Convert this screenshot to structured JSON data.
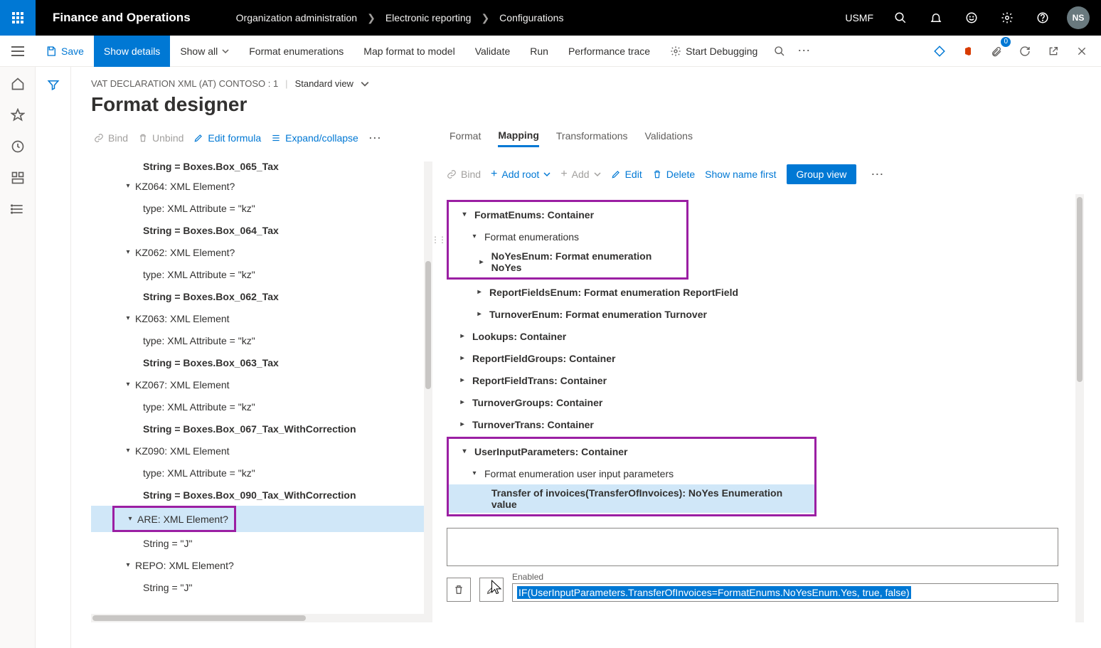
{
  "header": {
    "appTitle": "Finance and Operations",
    "breadcrumb": [
      "Organization administration",
      "Electronic reporting",
      "Configurations"
    ],
    "org": "USMF",
    "userInitials": "NS"
  },
  "toolbar": {
    "save": "Save",
    "showDetails": "Show details",
    "showAll": "Show all",
    "formatEnum": "Format enumerations",
    "mapFormat": "Map format to model",
    "validate": "Validate",
    "run": "Run",
    "perf": "Performance trace",
    "debug": "Start Debugging",
    "attachBadge": "0"
  },
  "pageHeader": {
    "crumb": "VAT DECLARATION XML (AT) CONTOSO : 1",
    "view": "Standard view",
    "title": "Format designer"
  },
  "leftActions": {
    "bind": "Bind",
    "unbind": "Unbind",
    "editFormula": "Edit formula",
    "expand": "Expand/collapse"
  },
  "leftTree": [
    {
      "indent": 55,
      "caret": "",
      "bold": true,
      "text": "String = Boxes.Box_065_Tax",
      "clip": true
    },
    {
      "indent": 44,
      "caret": "▾",
      "bold": false,
      "text": "KZ064: XML Element?"
    },
    {
      "indent": 55,
      "caret": "",
      "bold": false,
      "text": "type: XML Attribute = \"kz\""
    },
    {
      "indent": 55,
      "caret": "",
      "bold": true,
      "text": "String = Boxes.Box_064_Tax"
    },
    {
      "indent": 44,
      "caret": "▾",
      "bold": false,
      "text": "KZ062: XML Element?"
    },
    {
      "indent": 55,
      "caret": "",
      "bold": false,
      "text": "type: XML Attribute = \"kz\""
    },
    {
      "indent": 55,
      "caret": "",
      "bold": true,
      "text": "String = Boxes.Box_062_Tax"
    },
    {
      "indent": 44,
      "caret": "▾",
      "bold": false,
      "text": "KZ063: XML Element"
    },
    {
      "indent": 55,
      "caret": "",
      "bold": false,
      "text": "type: XML Attribute = \"kz\""
    },
    {
      "indent": 55,
      "caret": "",
      "bold": true,
      "text": "String = Boxes.Box_063_Tax"
    },
    {
      "indent": 44,
      "caret": "▾",
      "bold": false,
      "text": "KZ067: XML Element"
    },
    {
      "indent": 55,
      "caret": "",
      "bold": false,
      "text": "type: XML Attribute = \"kz\""
    },
    {
      "indent": 55,
      "caret": "",
      "bold": true,
      "text": "String = Boxes.Box_067_Tax_WithCorrection"
    },
    {
      "indent": 44,
      "caret": "▾",
      "bold": false,
      "text": "KZ090: XML Element"
    },
    {
      "indent": 55,
      "caret": "",
      "bold": false,
      "text": "type: XML Attribute = \"kz\""
    },
    {
      "indent": 55,
      "caret": "",
      "bold": true,
      "text": "String = Boxes.Box_090_Tax_WithCorrection"
    },
    {
      "indent": 44,
      "caret": "▾",
      "bold": false,
      "text": "ARE: XML Element?",
      "sel": true,
      "highlight": true
    },
    {
      "indent": 55,
      "caret": "",
      "bold": false,
      "text": "String = \"J\""
    },
    {
      "indent": 44,
      "caret": "▾",
      "bold": false,
      "text": "REPO: XML Element?"
    },
    {
      "indent": 55,
      "caret": "",
      "bold": false,
      "text": "String = \"J\""
    }
  ],
  "tabs": [
    "Format",
    "Mapping",
    "Transformations",
    "Validations"
  ],
  "activeTab": "Mapping",
  "rightActions": {
    "bind": "Bind",
    "addRoot": "Add root",
    "add": "Add",
    "edit": "Edit",
    "delete": "Delete",
    "showName": "Show name first",
    "groupView": "Group view"
  },
  "rightTreeBox1": [
    {
      "indent": 4,
      "caret": "▾",
      "bold": true,
      "text": "FormatEnums: Container"
    },
    {
      "indent": 18,
      "caret": "▾",
      "bold": false,
      "text": "Format enumerations"
    },
    {
      "indent": 28,
      "caret": "▸",
      "bold": true,
      "text": "NoYesEnum: Format enumeration NoYes"
    }
  ],
  "rightTreeMiddle": [
    {
      "indent": 28,
      "caret": "▸",
      "bold": true,
      "text": "ReportFieldsEnum: Format enumeration ReportField"
    },
    {
      "indent": 28,
      "caret": "▸",
      "bold": true,
      "text": "TurnoverEnum: Format enumeration Turnover"
    },
    {
      "indent": 4,
      "caret": "▸",
      "bold": true,
      "text": "Lookups: Container"
    },
    {
      "indent": 4,
      "caret": "▸",
      "bold": true,
      "text": "ReportFieldGroups: Container"
    },
    {
      "indent": 4,
      "caret": "▸",
      "bold": true,
      "text": "ReportFieldTrans: Container"
    },
    {
      "indent": 4,
      "caret": "▸",
      "bold": true,
      "text": "TurnoverGroups: Container"
    },
    {
      "indent": 4,
      "caret": "▸",
      "bold": true,
      "text": "TurnoverTrans: Container"
    }
  ],
  "rightTreeBox2": [
    {
      "indent": 4,
      "caret": "▾",
      "bold": true,
      "text": "UserInputParameters: Container"
    },
    {
      "indent": 18,
      "caret": "▾",
      "bold": false,
      "text": "Format enumeration user input parameters"
    },
    {
      "indent": 28,
      "caret": "",
      "bold": true,
      "text": "Transfer of invoices(TransferOfInvoices): NoYes Enumeration value",
      "sel": true
    }
  ],
  "formula": {
    "label": "Enabled",
    "value": "IF(UserInputParameters.TransferOfInvoices=FormatEnums.NoYesEnum.Yes, true, false)"
  }
}
